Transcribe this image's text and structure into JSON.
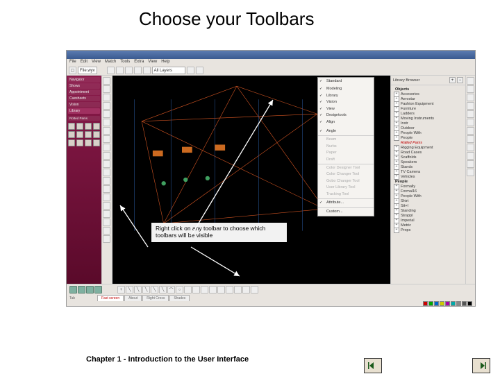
{
  "slide": {
    "title": "Choose your Toolbars",
    "callout": "Right click on any toolbar to choose which toolbars will be visible",
    "footer": "Chapter 1 - Introduction to the User Interface"
  },
  "window": {
    "title": "",
    "menubar": [
      "File",
      "Edit",
      "View",
      "Match",
      "Tools",
      "Extra",
      "View",
      "Help"
    ],
    "toolbar_file": "File.wyv",
    "toolbar_zoom": "All Layers"
  },
  "left_palette": {
    "tabs": [
      "Navigator",
      "Shows",
      "Appointment",
      "Cuesheets",
      "Vision",
      "Library"
    ],
    "highlight": "Library",
    "sub": "Rotted Pams"
  },
  "context_menu": {
    "items_checked": [
      "Standard",
      "",
      "Modeling",
      "Library",
      "Vision",
      "View",
      "Designtools",
      "Align",
      "",
      "",
      "Angle"
    ],
    "items_mid": [
      "Beam",
      "Nurbs",
      "Paper",
      "Draft"
    ],
    "items_dis": [
      "Color Designer Tool",
      "Color Changer Tool",
      "Gobo Changer Tool",
      "User Library Tool",
      "Tracking Tool"
    ],
    "items_last": [
      "Attribute...",
      "Custom..."
    ]
  },
  "library_panel": {
    "header": "Library Browser",
    "root": "Objects",
    "nodes": [
      "Accesories",
      "Aerostar",
      "Fashion Equipment",
      "Furniture",
      "Ladders",
      "Moving Instruments",
      "Instr",
      "Outdoor",
      "People With",
      "People",
      "Ralled Pams"
    ],
    "nodes2": [
      "Rigging Equipment",
      "Road Cases",
      "Scaffolds",
      "Speakers",
      "Stands",
      "TV Camera",
      "Vehicles"
    ],
    "nodes3_header": "People",
    "nodes3": [
      "Formally",
      "Formal16",
      "People With",
      "Shirt",
      "Sit+l",
      "Standing",
      "Strappl",
      "Imperial",
      "Metric",
      "Props"
    ]
  },
  "bottom_tabs": [
    "Tab",
    "Fast screen",
    "About",
    "Right Cross",
    "Shades"
  ],
  "status_colors": [
    "#c00",
    "#0a0",
    "#06c",
    "#cc0",
    "#a0a",
    "#0aa",
    "#888",
    "#555",
    "#000"
  ]
}
